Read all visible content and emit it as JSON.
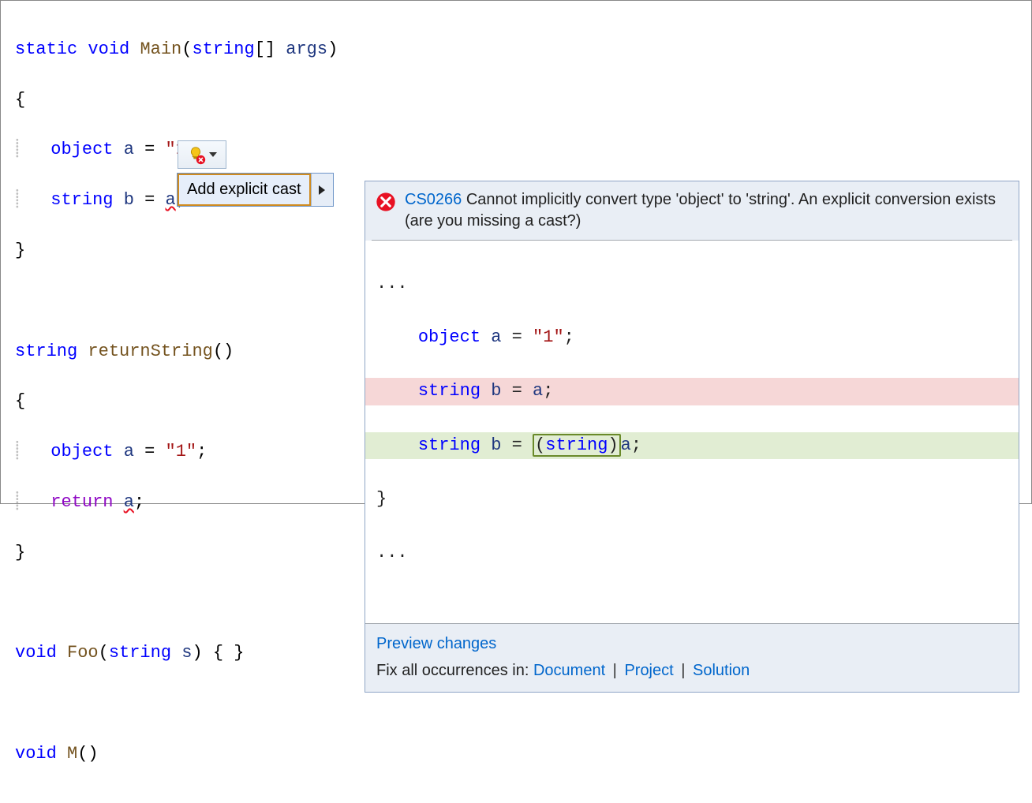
{
  "code": {
    "line1": {
      "static": "static",
      "void": "void",
      "main": "Main",
      "paren_open": "(",
      "stringarr": "string",
      "brackets": "[]",
      "args": "args",
      "paren_close": ")"
    },
    "line2": {
      "brace": "{"
    },
    "line3": {
      "object": "object",
      "a": "a",
      "eq": " = ",
      "str": "\"1\"",
      "semi": ";"
    },
    "line4": {
      "string": "string",
      "b": "b",
      "eq": " = ",
      "a": "a",
      "semi": ";"
    },
    "line5": {
      "brace": "}"
    },
    "line7": {
      "string": "string",
      "name": "returnString",
      "paren": "()"
    },
    "line8": {
      "brace": "{"
    },
    "line9": {
      "object": "object",
      "a": "a",
      "eq": " = ",
      "str": "\"1\"",
      "semi": ";"
    },
    "line10": {
      "return": "return",
      "a": "a",
      "semi": ";"
    },
    "line11": {
      "brace": "}"
    },
    "line13": {
      "void": "void",
      "foo": "Foo",
      "paren_open": "(",
      "string": "string",
      "s": "s",
      "paren_close": ")",
      "braces": " { }"
    },
    "line15": {
      "void": "void",
      "m": "M",
      "paren": "()"
    }
  },
  "quickfix": {
    "label": "Add explicit cast"
  },
  "preview": {
    "error_code": "CS0266",
    "error_msg": " Cannot implicitly convert type 'object' to 'string'. An explicit conversion exists (are you missing a cast?)",
    "ellipsis_top": "...",
    "line_decl": {
      "object": "object",
      "a": "a",
      "eq": " = ",
      "str": "\"1\"",
      "semi": ";"
    },
    "line_del": {
      "string": "string",
      "b": "b",
      "eq": " = ",
      "a": "a",
      "semi": ";"
    },
    "line_add": {
      "string": "string",
      "b": "b",
      "eq": " = ",
      "cast_open": "(",
      "cast_type": "string",
      "cast_close": ")",
      "a": "a",
      "semi": ";"
    },
    "line_brace": "}",
    "ellipsis_bottom": "...",
    "preview_changes": "Preview changes",
    "fix_label": "Fix all occurrences in: ",
    "scopes": {
      "document": "Document",
      "project": "Project",
      "solution": "Solution"
    }
  }
}
